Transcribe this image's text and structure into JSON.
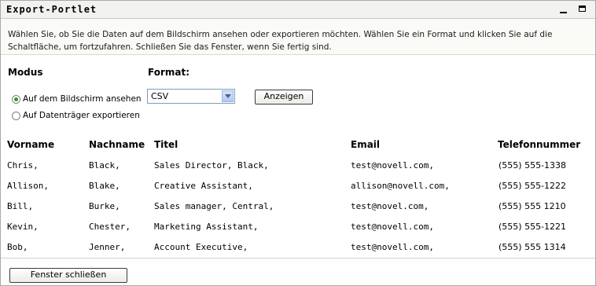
{
  "portlet": {
    "title": "Export-Portlet"
  },
  "description": "Wählen Sie, ob Sie die Daten auf dem Bildschirm ansehen oder exportieren möchten. Wählen Sie ein Format und klicken Sie auf die Schaltfläche, um fortzufahren. Schließen Sie das Fenster, wenn Sie fertig sind.",
  "mode": {
    "label": "Modus",
    "options": [
      {
        "label": "Auf dem Bildschirm ansehen",
        "checked": true
      },
      {
        "label": "Auf Datenträger exportieren",
        "checked": false
      }
    ]
  },
  "format": {
    "label": "Format:",
    "selected": "CSV"
  },
  "buttons": {
    "show": "Anzeigen",
    "close": "Fenster schließen"
  },
  "table": {
    "headers": [
      "Vorname",
      "Nachname",
      "Titel",
      "Email",
      "Telefonnummer"
    ],
    "rows": [
      [
        "Chris,",
        "Black,",
        "Sales Director, Black,",
        "test@novell.com,",
        "(555) 555-1338"
      ],
      [
        "Allison,",
        "Blake,",
        "Creative Assistant,",
        "allison@novell.com,",
        "(555) 555-1222"
      ],
      [
        "Bill,",
        "Burke,",
        "Sales manager, Central,",
        "test@novel.com,",
        "(555) 555 1210"
      ],
      [
        "Kevin,",
        "Chester,",
        "Marketing Assistant,",
        "test@novell.com,",
        "(555) 555-1221"
      ],
      [
        "Bob,",
        "Jenner,",
        "Account Executive,",
        "test@novell.com,",
        "(555) 555 1314"
      ]
    ]
  },
  "colors": {
    "selected_radio": "#2a9a2a",
    "title_bar": "#f2f2f0"
  }
}
